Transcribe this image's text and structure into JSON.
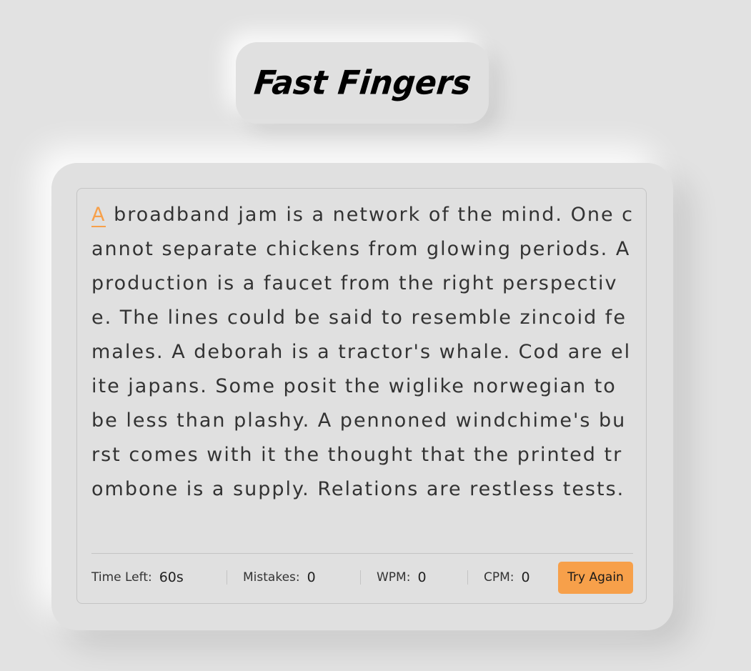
{
  "header": {
    "title": "Fast Fingers"
  },
  "passage": {
    "current_char": "A",
    "rest": " broadband jam is a network of the mind. One cannot separate chickens from glowing periods. A production is a faucet from the right perspective. The lines could be said to resemble zincoid females. A deborah is a tractor's whale. Cod are elite japans. Some posit the wiglike norwegian to be less than plashy. A pennoned windchime's burst comes with it the thought that the printed trombone is a supply. Relations are restless tests."
  },
  "stats": {
    "time_left_label": "Time Left:",
    "time_left_value": "60s",
    "mistakes_label": "Mistakes:",
    "mistakes_value": "0",
    "wpm_label": "WPM:",
    "wpm_value": "0",
    "cpm_label": "CPM:",
    "cpm_value": "0"
  },
  "actions": {
    "try_again_label": "Try Again"
  },
  "colors": {
    "background": "#e2e2e2",
    "accent": "#f7a04a",
    "text": "#333333"
  }
}
